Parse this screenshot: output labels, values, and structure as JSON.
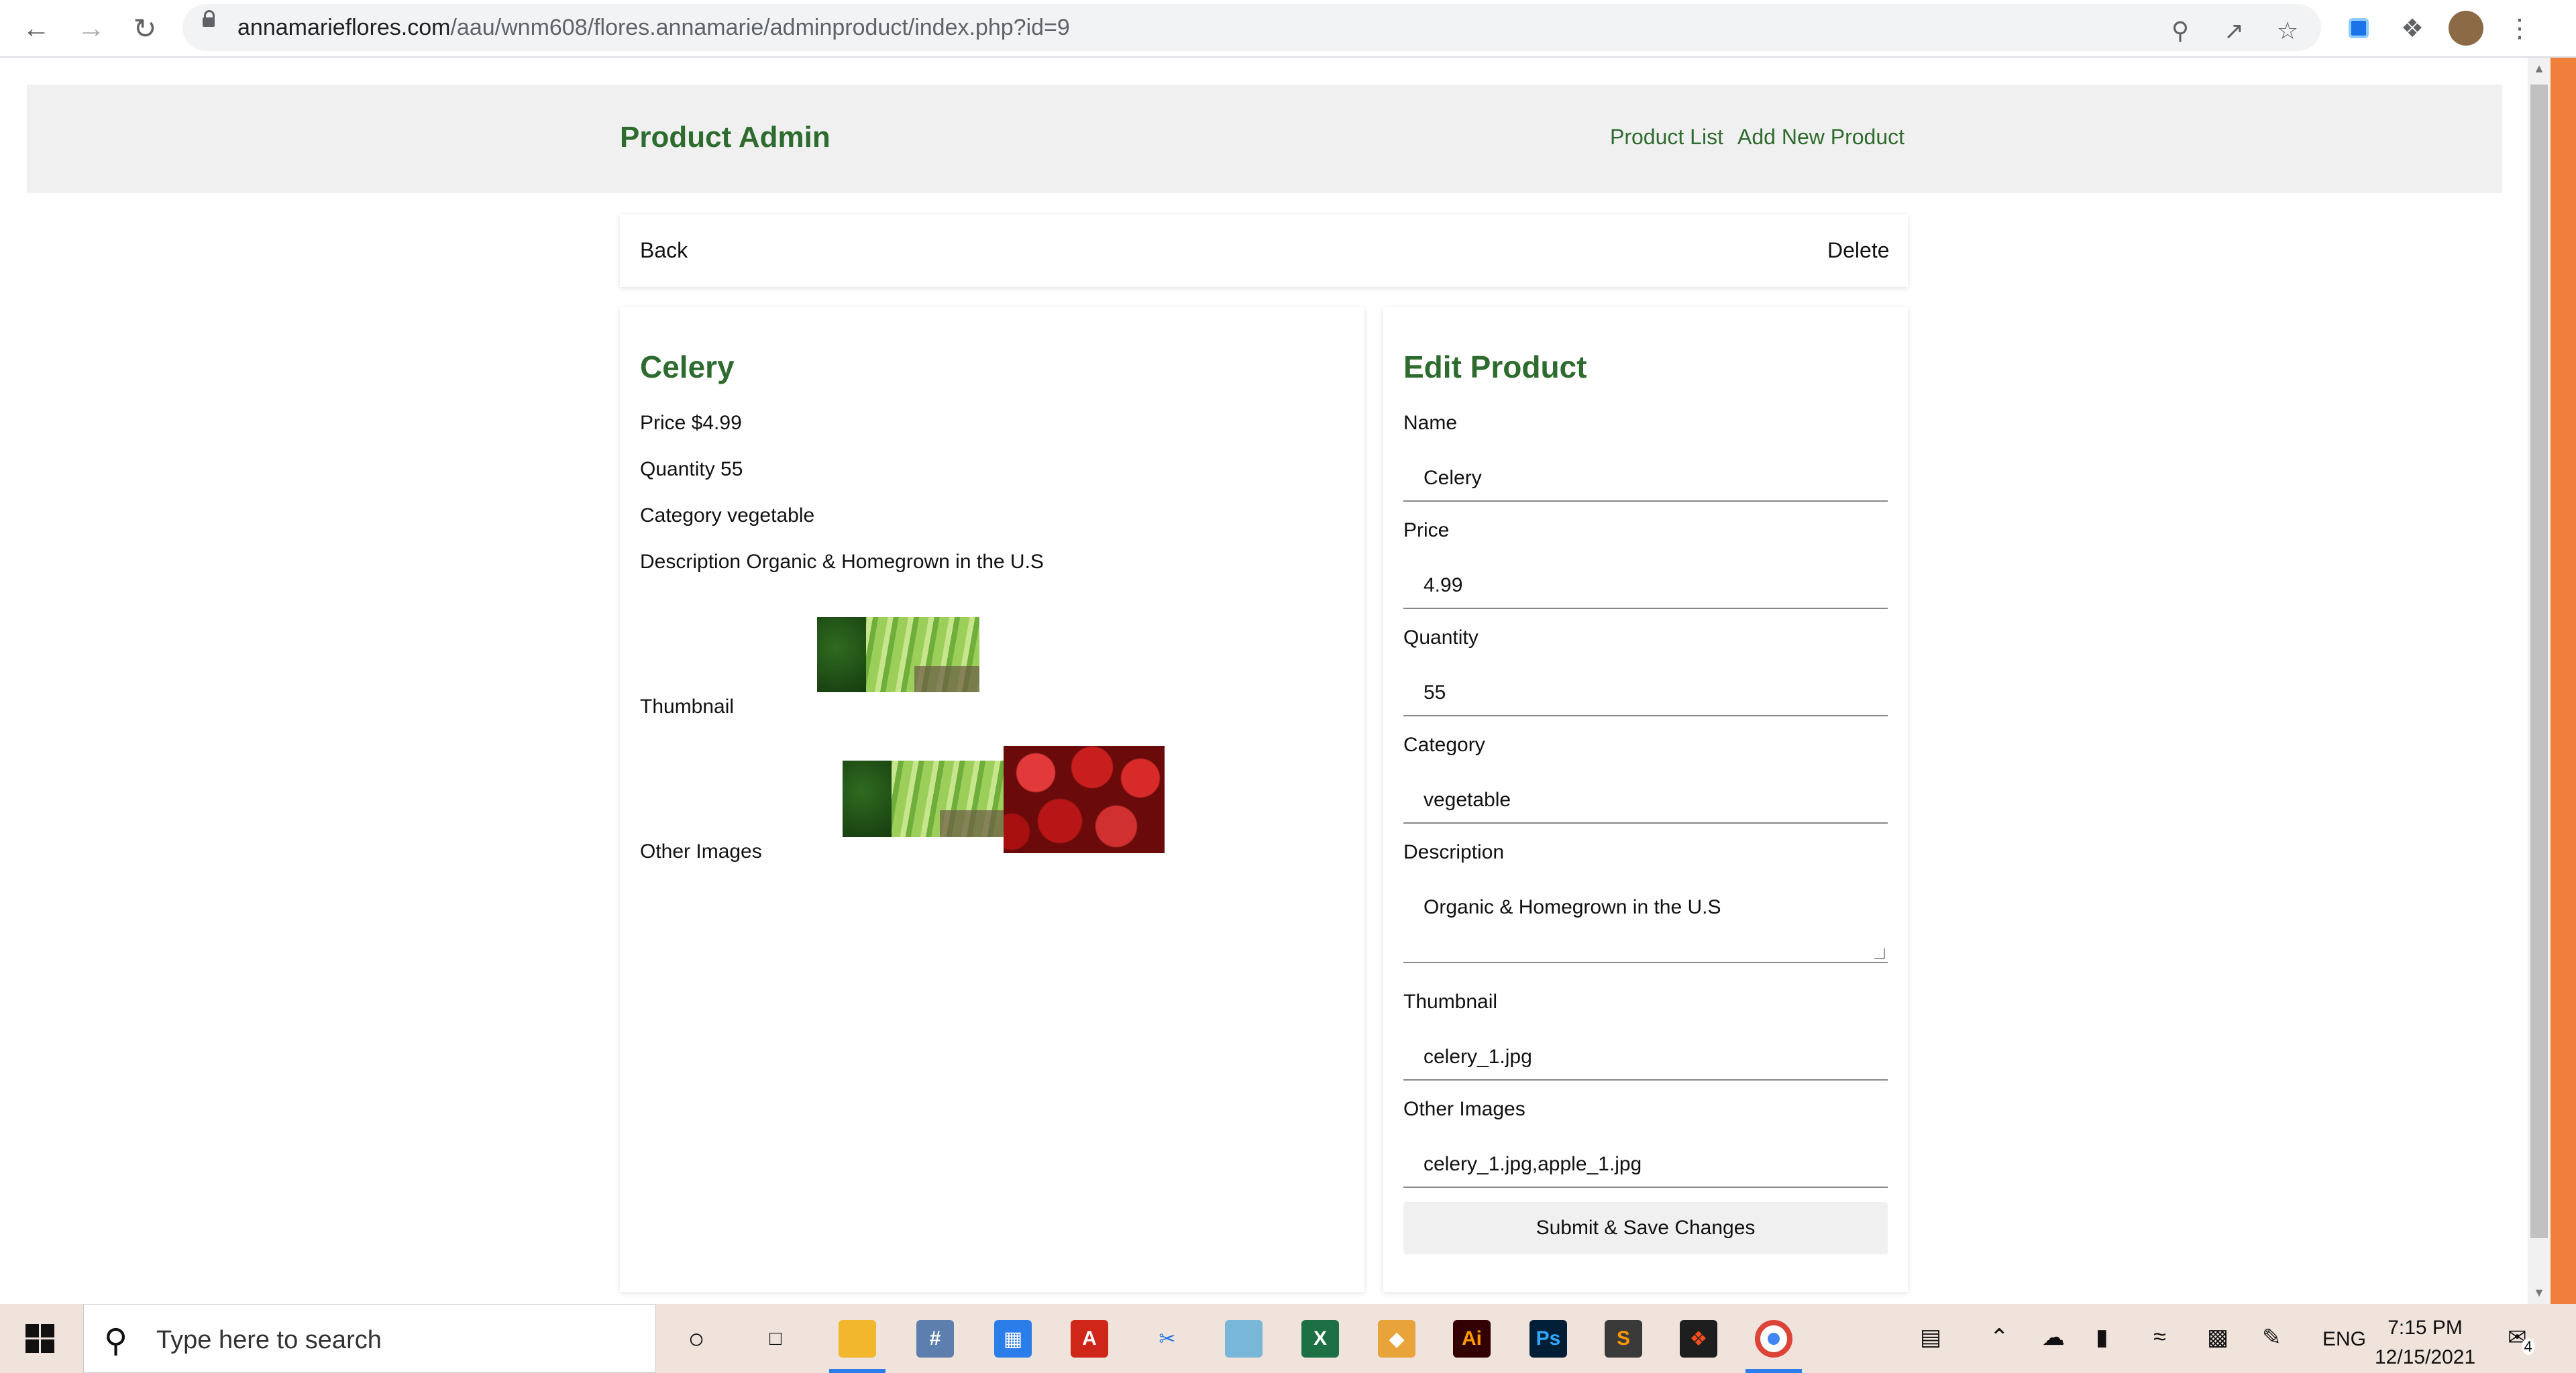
{
  "browser": {
    "url_domain": "annamarieflores.com",
    "url_path": "/aau/wnm608/flores.annamarie/adminproduct/index.php?id=9"
  },
  "header": {
    "brand": "Product Admin",
    "nav": [
      "Product List",
      "Add New Product"
    ]
  },
  "actions": {
    "back": "Back",
    "delete": "Delete"
  },
  "product": {
    "name": "Celery",
    "price_line": "Price $4.99",
    "quantity_line": "Quantity 55",
    "category_line": "Category vegetable",
    "description_line": "Description Organic & Homegrown in the U.S",
    "thumbnail_label": "Thumbnail",
    "other_images_label": "Other Images"
  },
  "form": {
    "title": "Edit Product",
    "name_label": "Name",
    "name_value": "Celery",
    "price_label": "Price",
    "price_value": "4.99",
    "quantity_label": "Quantity",
    "quantity_value": "55",
    "category_label": "Category",
    "category_value": "vegetable",
    "description_label": "Description",
    "description_value": "Organic & Homegrown in the U.S",
    "thumbnail_label": "Thumbnail",
    "thumbnail_value": "celery_1.jpg",
    "other_images_label": "Other Images",
    "other_images_value": "celery_1.jpg,apple_1.jpg",
    "submit": "Submit & Save Changes"
  },
  "taskbar": {
    "search_placeholder": "Type here to search",
    "language": "ENG",
    "time": "7:15 PM",
    "date": "12/15/2021",
    "notifications": "4"
  }
}
